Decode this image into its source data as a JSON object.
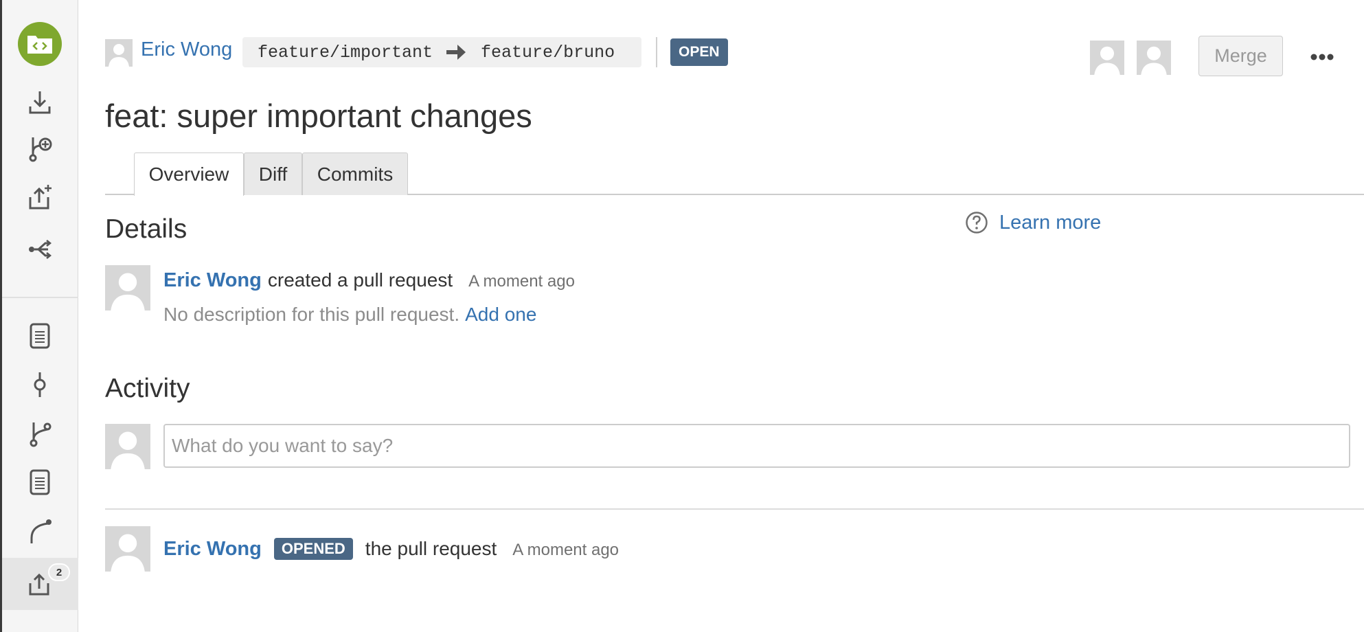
{
  "sidebar": {
    "items": [
      {
        "icon": "download-icon",
        "label": "Clone"
      },
      {
        "icon": "create-branch-icon",
        "label": "Create branch"
      },
      {
        "icon": "create-pull-request-icon",
        "label": "Create pull request"
      },
      {
        "icon": "fork-icon",
        "label": "Fork"
      },
      {
        "icon": "source-icon",
        "label": "Source"
      },
      {
        "icon": "commits-icon",
        "label": "Commits"
      },
      {
        "icon": "branches-icon",
        "label": "Branches"
      },
      {
        "icon": "source-files-icon",
        "label": "Files"
      },
      {
        "icon": "forks-icon",
        "label": "Forks"
      },
      {
        "icon": "pull-requests-icon",
        "label": "Pull requests"
      }
    ],
    "pull_requests_count": "2",
    "active_item": "pull-requests-icon"
  },
  "header": {
    "author": "Eric Wong",
    "source_branch": "feature/important",
    "target_branch": "feature/bruno",
    "status": "OPEN",
    "merge_label": "Merge",
    "more_icon": "more-icon"
  },
  "pr": {
    "title": "feat: super important changes"
  },
  "tabs": [
    {
      "label": "Overview",
      "active": true
    },
    {
      "label": "Diff",
      "active": false
    },
    {
      "label": "Commits",
      "active": false
    }
  ],
  "details": {
    "heading": "Details",
    "learn_more": "Learn more",
    "author": "Eric Wong",
    "action": "created a pull request",
    "time": "A moment ago",
    "no_description": "No description for this pull request.",
    "add_description": "Add one"
  },
  "activity": {
    "heading": "Activity",
    "comment_placeholder": "What do you want to say?",
    "events": [
      {
        "user": "Eric Wong",
        "badge": "OPENED",
        "text": "the pull request",
        "time": "A moment ago"
      }
    ]
  },
  "colors": {
    "link": "#3572b0",
    "status_badge": "#4a6785",
    "repo_avatar": "#7fa82e"
  }
}
